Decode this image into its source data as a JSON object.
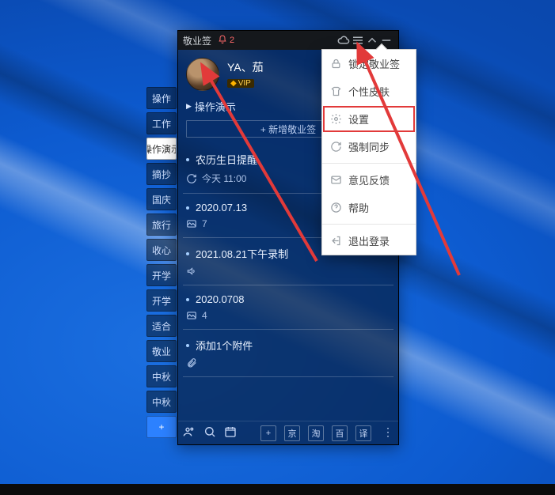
{
  "titlebar": {
    "app_name": "敬业签",
    "notif_count": "2"
  },
  "user": {
    "name": "YA、茄",
    "badge": "VIP"
  },
  "crumb": {
    "name": "操作演示"
  },
  "add_new": "+ 新增敬业签",
  "items": [
    {
      "title": "农历生日提醒",
      "meta_icon": "refresh",
      "meta": "今天 11:00"
    },
    {
      "title": "2020.07.13",
      "meta_icon": "image",
      "meta": "7"
    },
    {
      "title": "2021.08.21下午录制",
      "meta_icon": "sound",
      "meta": ""
    },
    {
      "title": "2020.0708",
      "meta_icon": "image",
      "meta": "4"
    },
    {
      "title": "添加1个附件",
      "meta_icon": "clip",
      "meta": ""
    }
  ],
  "side_tabs": [
    "操作",
    "工作",
    "操作演示",
    "摘抄",
    "国庆",
    "旅行",
    "收心",
    "开学",
    "开学",
    "适合",
    "敬业",
    "中秋",
    "中秋"
  ],
  "menu": {
    "lock": "锁定敬业签",
    "skin": "个性皮肤",
    "settings": "设置",
    "sync": "强制同步",
    "feedback": "意见反馈",
    "help": "帮助",
    "logout": "退出登录"
  },
  "bottombar": {
    "sq1": "+",
    "sq2": "京",
    "sq3": "淘",
    "sq4": "百",
    "sq5": "译"
  }
}
